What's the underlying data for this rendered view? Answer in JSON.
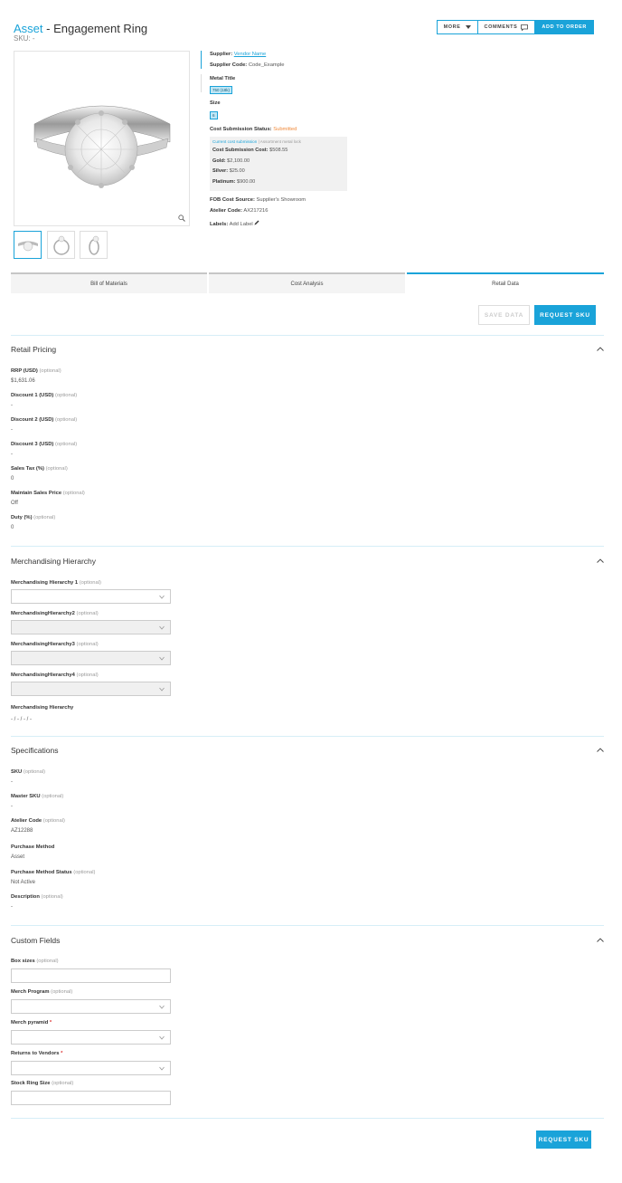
{
  "header": {
    "asset_label": "Asset",
    "separator": " - ",
    "product_title": "Engagement Ring",
    "sku_line": "SKU: -"
  },
  "top_actions": {
    "more": "MORE",
    "comments": "COMMENTS",
    "add_to_order": "ADD TO ORDER"
  },
  "product": {
    "supplier_label": "Supplier:",
    "supplier_value": "Vendor Name",
    "supplier_code_label": "Supplier Code:",
    "supplier_code_value": "Code_Example",
    "metal_title_label": "Metal Title",
    "metal_chip": "750 (18k)",
    "size_label": "Size",
    "size_chip": "6",
    "cost_status_label": "Cost Submission Status:",
    "cost_status_value": "Submitted",
    "cost_box": {
      "current_link": "Current cost submission",
      "divider": "|",
      "note": "Assortment metal lock",
      "rows": [
        {
          "label": "Cost Submission Cost:",
          "value": "$508.55"
        },
        {
          "label": "Gold:",
          "value": "$2,100.00"
        },
        {
          "label": "Silver:",
          "value": "$25.00"
        },
        {
          "label": "Platinum:",
          "value": "$900.00"
        }
      ]
    },
    "fob_label": "FOB Cost Source:",
    "fob_value": "Supplier's Showroom",
    "atelier_label": "Atelier Code:",
    "atelier_value": "AX217216",
    "labels_label": "Labels:",
    "labels_value": "Add Label"
  },
  "tabs": [
    {
      "label": "Bill of Materials"
    },
    {
      "label": "Cost Analysis"
    },
    {
      "label": "Retail Data"
    }
  ],
  "buttons": {
    "save_data": "SAVE DATA",
    "request_sku": "REQUEST SKU"
  },
  "optional_text": "(optional)",
  "retail_pricing": {
    "title": "Retail Pricing",
    "fields": [
      {
        "label": "RRP (USD)",
        "value": "$1,631.06"
      },
      {
        "label": "Discount 1 (USD)",
        "value": "-"
      },
      {
        "label": "Discount 2 (USD)",
        "value": "-"
      },
      {
        "label": "Discount 3 (USD)",
        "value": "-"
      },
      {
        "label": "Sales Tax (%)",
        "value": "0"
      },
      {
        "label": "Maintain Sales Price",
        "value": "Off"
      },
      {
        "label": "Duty (%)",
        "value": "0"
      }
    ]
  },
  "merch_hierarchy": {
    "title": "Merchandising Hierarchy",
    "selects": [
      {
        "label": "Merchandising Hierarchy 1"
      },
      {
        "label": "MerchandisingHierarchy2"
      },
      {
        "label": "MerchandisingHierarchy3"
      },
      {
        "label": "MerchandisingHierarchy4"
      }
    ],
    "summary_label": "Merchandising Hierarchy",
    "summary_value": "- / - / - / -"
  },
  "specifications": {
    "title": "Specifications",
    "fields": [
      {
        "label": "SKU",
        "optional": "(optional)",
        "value": "-"
      },
      {
        "label": "Master SKU",
        "optional": "(optional)",
        "value": "-"
      },
      {
        "label": "Atelier Code",
        "optional": "(optional)",
        "value": "AZ12288"
      },
      {
        "label": "Purchase Method",
        "optional": "",
        "value": "Asset"
      },
      {
        "label": "Purchase Method Status",
        "optional": "(optional)",
        "value": "Not Active"
      },
      {
        "label": "Description",
        "optional": "(optional)",
        "value": "-"
      }
    ]
  },
  "custom_fields": {
    "title": "Custom Fields",
    "fields": [
      {
        "label": "Box sizes",
        "suffix": "(optional)"
      },
      {
        "label": "Merch Program",
        "suffix": "(optional)"
      },
      {
        "label": "Merch pyramid",
        "suffix": "*"
      },
      {
        "label": "Returns to Vendors",
        "suffix": "*"
      },
      {
        "label": "Stock Ring Size",
        "suffix": "(optional)"
      }
    ]
  },
  "colors": {
    "accent": "#1aa3d9",
    "status_orange": "#f08a3b"
  },
  "icons": [
    "chevron-down-icon",
    "chevron-up-icon",
    "comment-icon",
    "zoom-icon",
    "pencil-icon",
    "ring-image"
  ]
}
